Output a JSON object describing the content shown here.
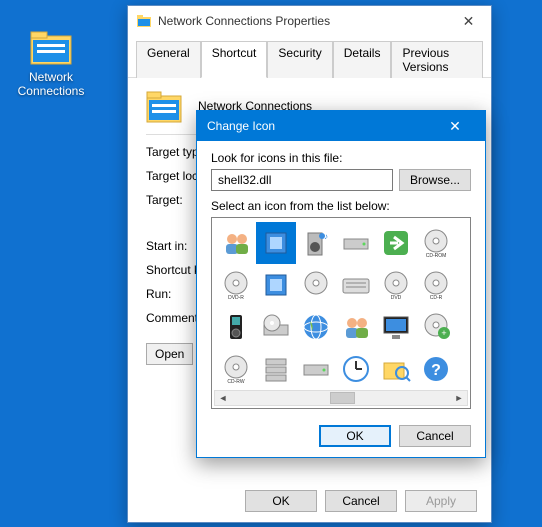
{
  "desktop": {
    "icon_label": "Network\nConnections"
  },
  "properties_window": {
    "title": "Network Connections Properties",
    "tabs": [
      "General",
      "Shortcut",
      "Security",
      "Details",
      "Previous Versions"
    ],
    "active_tab_index": 1,
    "item_name": "Network Connections",
    "fields": {
      "target_type_label": "Target typ",
      "target_loc_label": "Target loc",
      "target_label": "Target:",
      "startin_label": "Start in:",
      "shortcut_label": "Shortcut k",
      "run_label": "Run:",
      "comment_label": "Comment:"
    },
    "open_file_location_label": "Open",
    "footer": {
      "ok": "OK",
      "cancel": "Cancel",
      "apply": "Apply"
    }
  },
  "change_icon_dialog": {
    "title": "Change Icon",
    "look_label": "Look for icons in this file:",
    "file_value": "shell32.dll",
    "browse_label": "Browse...",
    "select_label": "Select an icon from the list below:",
    "selected_index": 1,
    "icons": [
      "people-group-icon",
      "computer-chip-icon",
      "speaker-music-icon",
      "drive-icon",
      "arrow-right-icon",
      "cd-rom-disc-icon",
      "dvd-r-disc-icon",
      "blue-chip-icon",
      "blue-disc-icon",
      "keyboard-icon",
      "dvd-disc-icon",
      "cd-r-disc-icon",
      "mp3-player-icon",
      "disc-drive-icon",
      "globe-icon",
      "two-people-icon",
      "monitor-icon",
      "disc-plus-icon",
      "cd-rw-disc-icon",
      "server-icon",
      "hard-drive-icon",
      "clock-icon",
      "search-folder-icon",
      "help-question-icon",
      "disc-icon",
      "dvd-ram-disc-icon",
      "drive-stack-icon",
      "server-stack-icon"
    ],
    "footer": {
      "ok": "OK",
      "cancel": "Cancel"
    }
  }
}
